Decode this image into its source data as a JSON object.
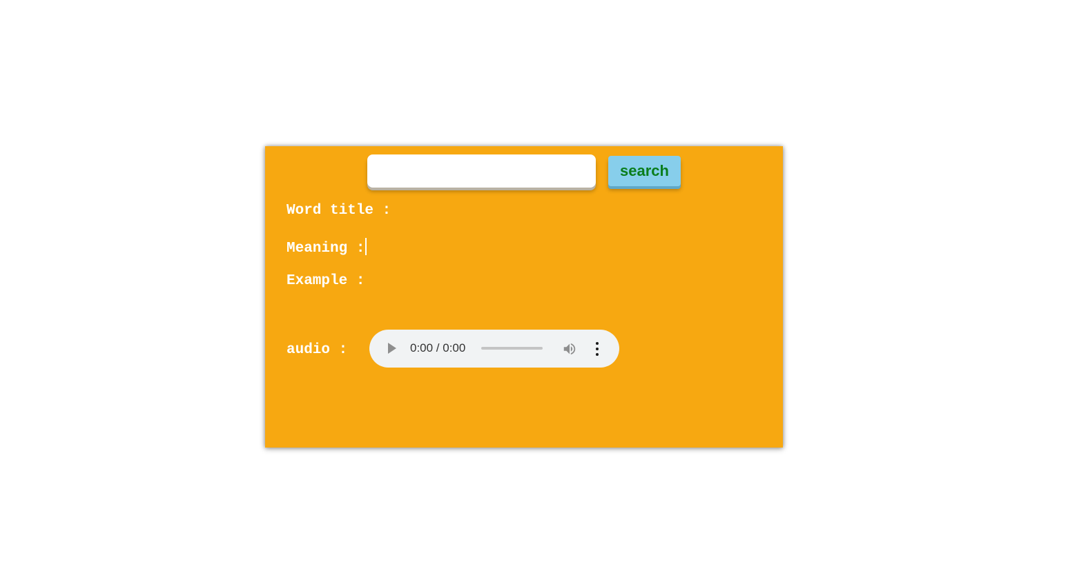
{
  "search": {
    "input_value": "",
    "input_placeholder": "",
    "button_label": "search"
  },
  "fields": {
    "word_title_label": "Word title :",
    "meaning_label": "Meaning :",
    "example_label": "Example :",
    "audio_label": "audio :"
  },
  "audio_player": {
    "time_display": "0:00 / 0:00",
    "progress": 0,
    "icons": [
      "play-icon",
      "volume-icon",
      "more-options-icon"
    ]
  },
  "colors": {
    "card_background": "#f7a811",
    "button_background": "#87ceeb",
    "button_text": "#0a7d1c",
    "label_text": "#ffffff",
    "player_background": "#f1f3f4"
  }
}
